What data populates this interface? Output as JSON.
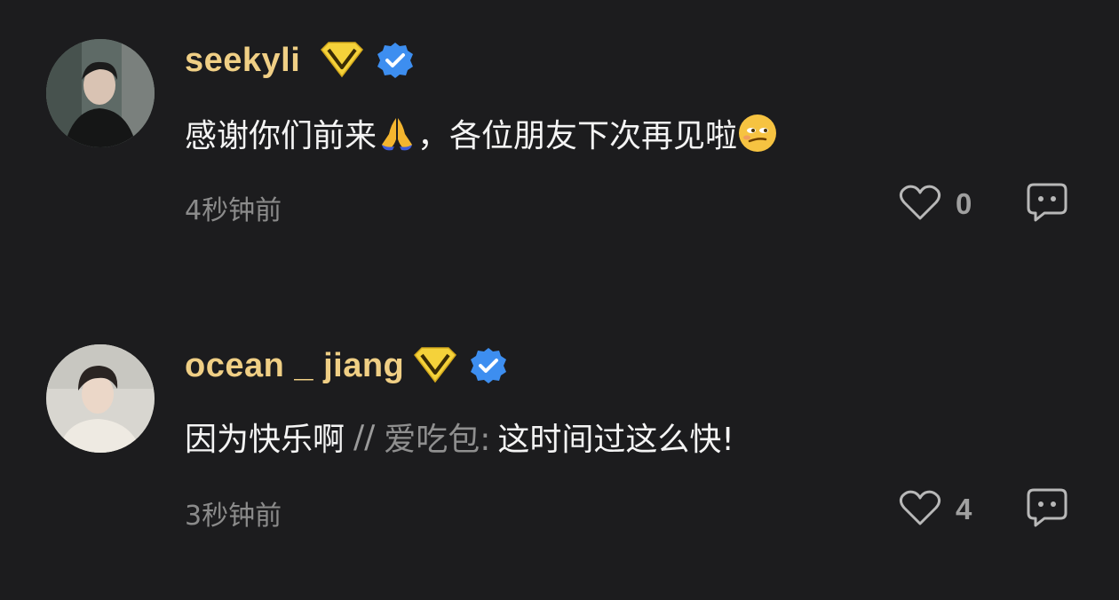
{
  "comments": [
    {
      "username": "seekyli",
      "text_before_emoji": "感谢你们前来",
      "text_middle": "，各位朋友下次再见啦",
      "reply_separator": "",
      "reply_author": "",
      "reply_text": "",
      "time": "4秒钟前",
      "likes": "0",
      "icons": [
        "vip-diamond-icon",
        "verified-check-icon",
        "pray-hands-emoji",
        "smirk-face-emoji",
        "heart-outline-icon",
        "chat-bubble-icon"
      ]
    },
    {
      "username": "ocean _ jiang",
      "text_before_emoji": "因为快乐啊",
      "text_middle": "",
      "reply_separator": "//",
      "reply_author": "爱吃包:",
      "reply_text": "这时间过这么快!",
      "time": "3秒钟前",
      "likes": "4",
      "icons": [
        "vip-diamond-icon",
        "verified-check-icon",
        "heart-outline-icon",
        "chat-bubble-icon"
      ]
    }
  ],
  "colors": {
    "background": "#1c1c1e",
    "username": "#f0cf85",
    "verified": "#3d8ef0",
    "vip": "#f5d23a",
    "meta": "#8b8b8b"
  }
}
